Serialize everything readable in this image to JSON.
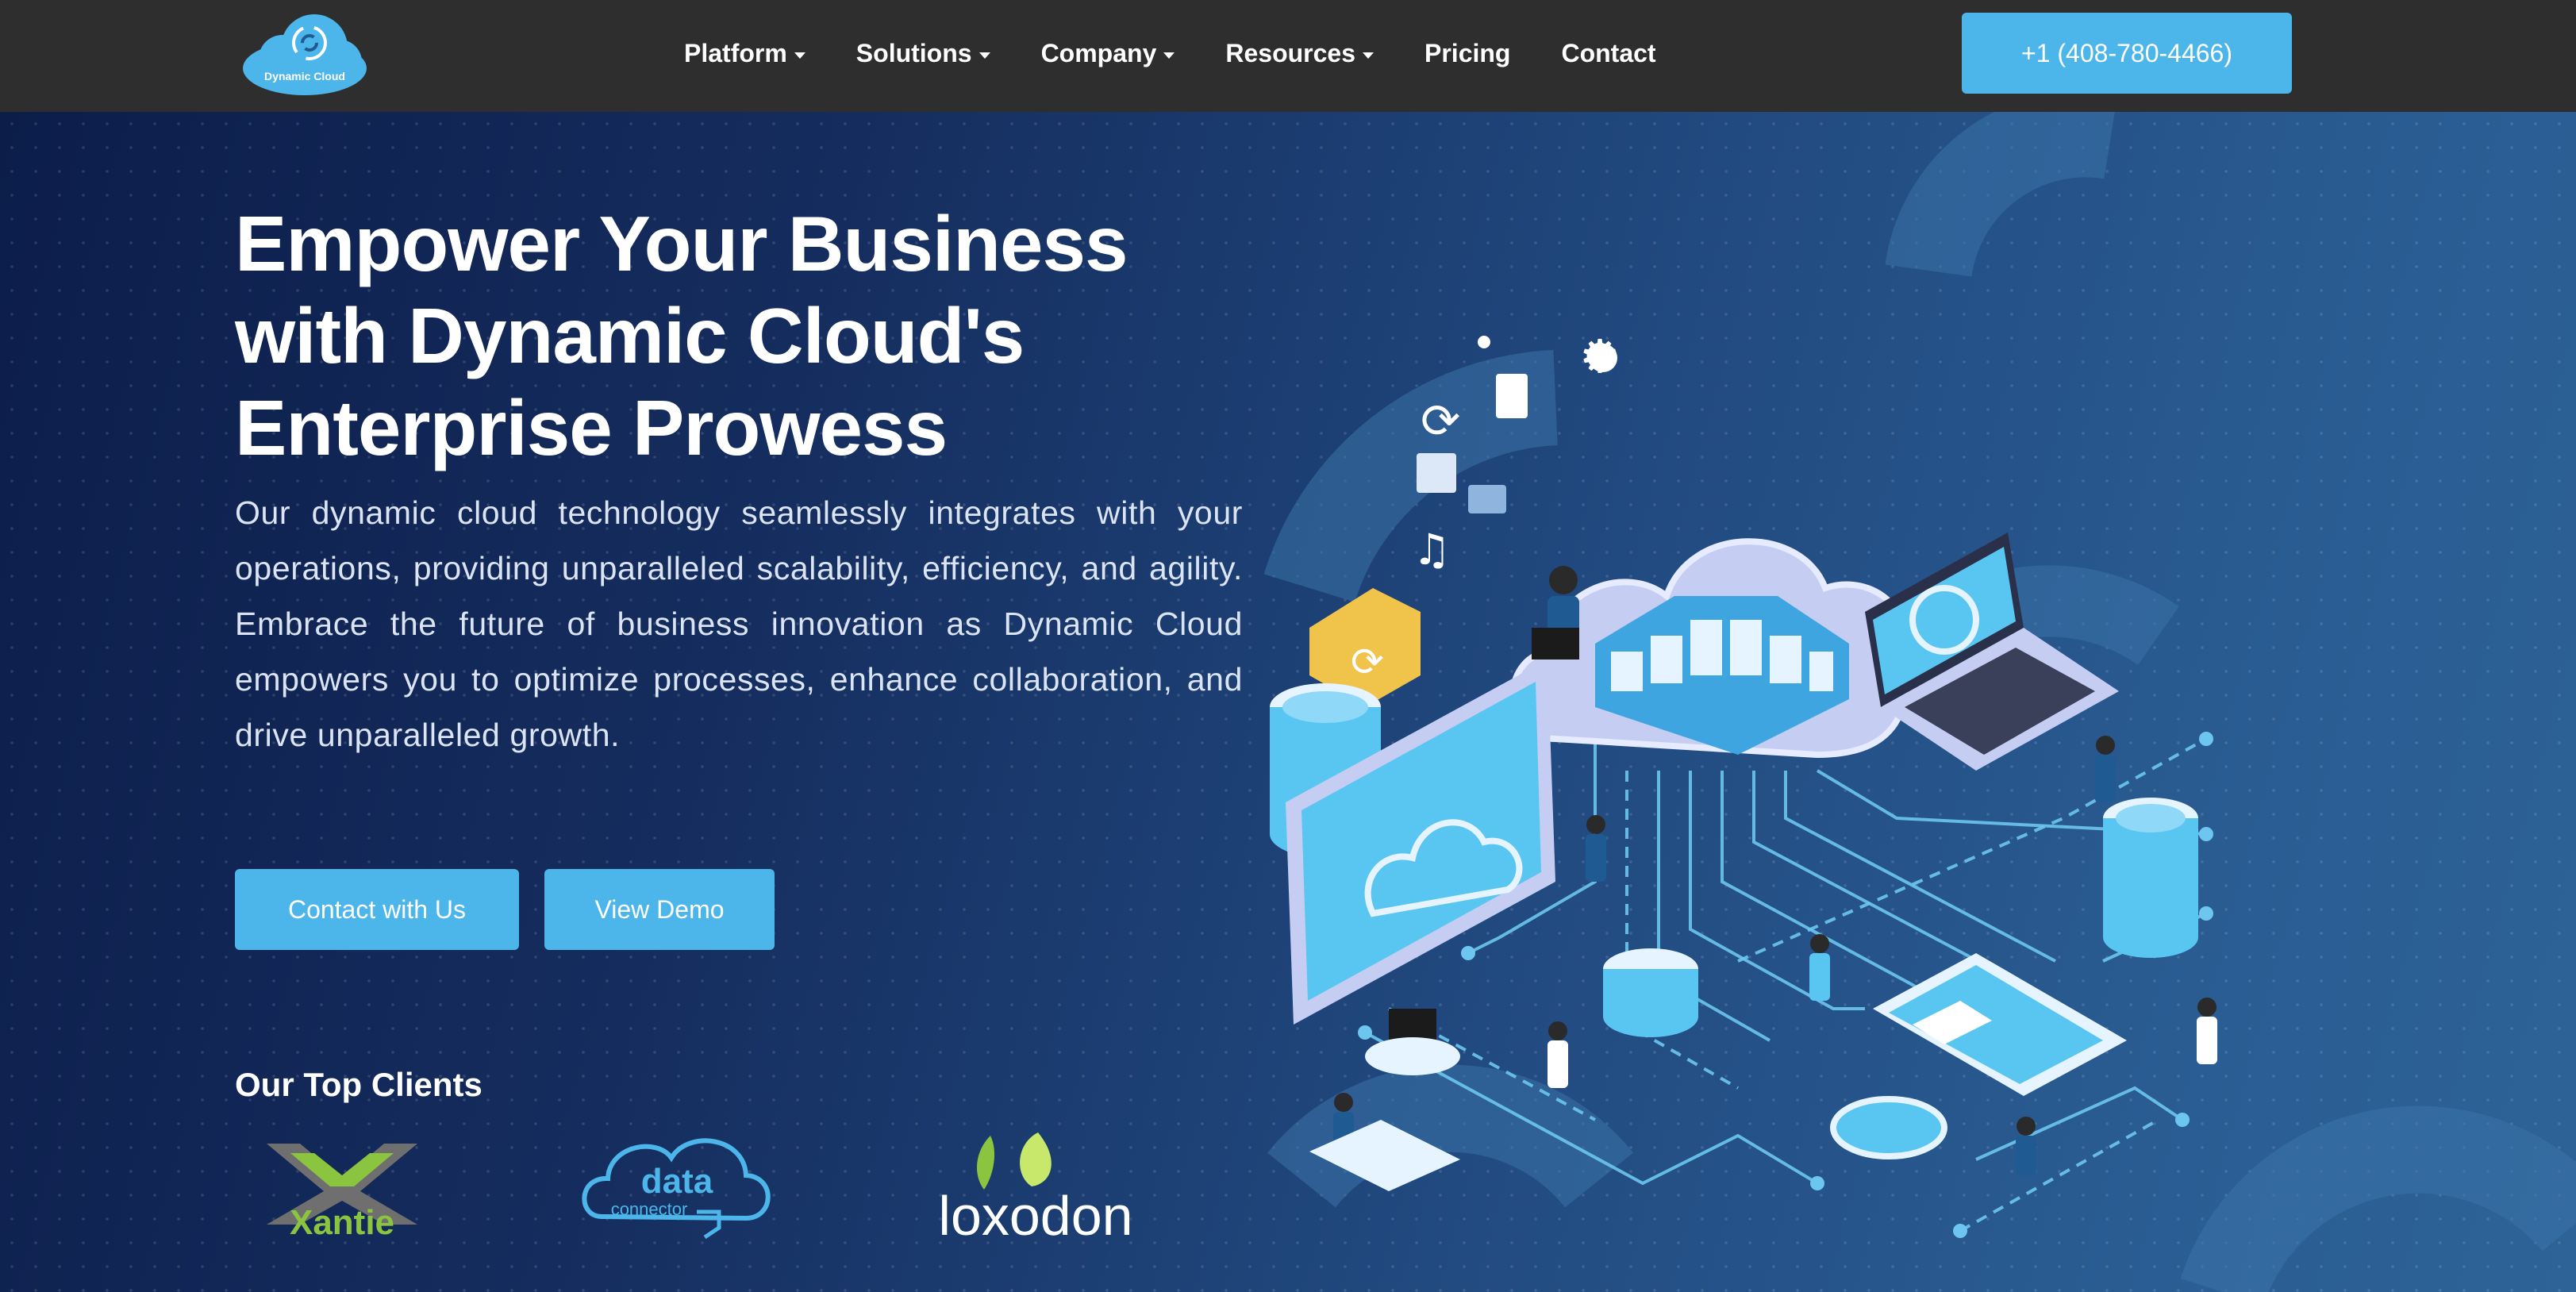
{
  "brand": {
    "logo_text": "Dynamic Cloud"
  },
  "nav": {
    "items": [
      {
        "label": "Platform",
        "dropdown": true
      },
      {
        "label": "Solutions",
        "dropdown": true
      },
      {
        "label": "Company",
        "dropdown": true
      },
      {
        "label": "Resources",
        "dropdown": true
      },
      {
        "label": "Pricing",
        "dropdown": false
      },
      {
        "label": "Contact",
        "dropdown": false
      }
    ],
    "phone": "+1 (408-780-4466)"
  },
  "hero": {
    "title_lines": [
      "Empower Your Business",
      "with Dynamic Cloud's",
      "Enterprise Prowess"
    ],
    "description": "Our dynamic cloud technology seamlessly integrates with your operations, providing unparalleled scalability, efficiency, and agility. Embrace the future of business innovation as Dynamic Cloud empowers you to optimize processes, enhance collaboration, and drive unparalleled growth.",
    "cta_primary": "Contact with Us",
    "cta_secondary": "View Demo"
  },
  "clients": {
    "title": "Our Top Clients",
    "logos": [
      {
        "name": "Xantie"
      },
      {
        "name": "data",
        "sub": "connector"
      },
      {
        "name": "loxodon"
      }
    ]
  },
  "colors": {
    "nav_bg": "#2e2e2e",
    "accent": "#4cb6ea",
    "hero_dark": "#0c1d4a",
    "hero_light": "#2d6397"
  }
}
